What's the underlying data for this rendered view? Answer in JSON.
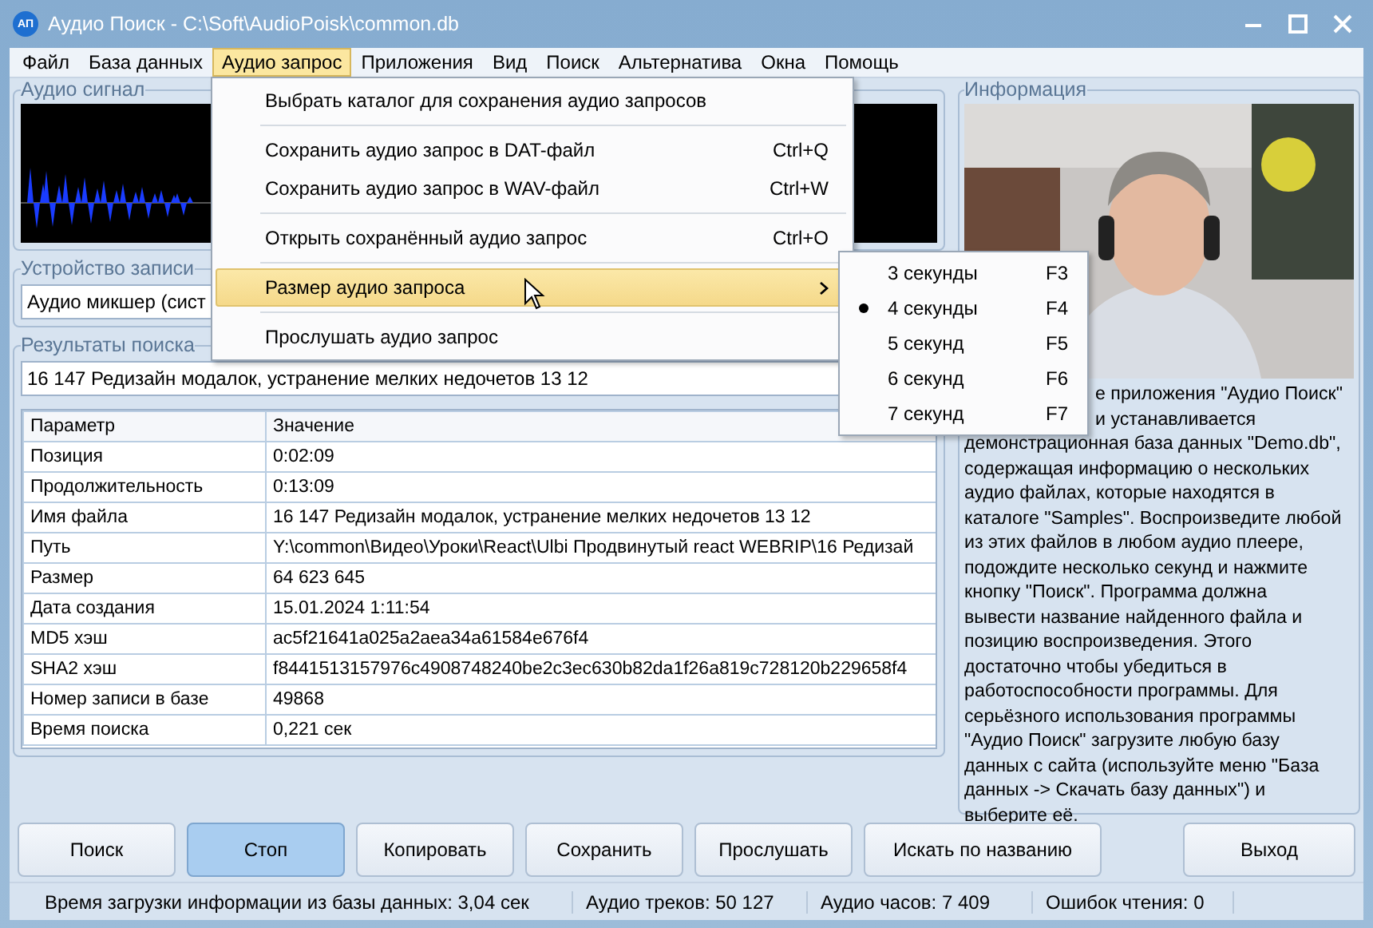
{
  "window": {
    "icon_text": "АП",
    "title": "Аудио Поиск - C:\\Soft\\AudioPoisk\\common.db"
  },
  "menu_bar": [
    {
      "label": "Файл",
      "selected": false
    },
    {
      "label": "База данных",
      "selected": false
    },
    {
      "label": "Аудио запрос",
      "selected": true
    },
    {
      "label": "Приложения",
      "selected": false
    },
    {
      "label": "Вид",
      "selected": false
    },
    {
      "label": "Поиск",
      "selected": false
    },
    {
      "label": "Альтернатива",
      "selected": false
    },
    {
      "label": "Окна",
      "selected": false
    },
    {
      "label": "Помощь",
      "selected": false
    }
  ],
  "audio_signal": {
    "title": "Аудио сигнал"
  },
  "recording_device": {
    "title": "Устройство записи",
    "value": "Аудио микшер (сист"
  },
  "search_results": {
    "title": "Результаты поиска",
    "found": "16 147 Редизайн модалок, устранение мелких недочетов 13 12",
    "columns": [
      "Параметр",
      "Значение"
    ],
    "rows": [
      [
        "Позиция",
        "0:02:09"
      ],
      [
        "Продолжительность",
        "0:13:09"
      ],
      [
        "Имя файла",
        "16 147 Редизайн модалок, устранение мелких недочетов 13 12"
      ],
      [
        "Путь",
        "Y:\\common\\Видео\\Уроки\\React\\Ulbi Продвинутый react WEBRIP\\16 Редизай"
      ],
      [
        "Размер",
        "64 623 645"
      ],
      [
        "Дата создания",
        "15.01.2024 1:11:54"
      ],
      [
        "MD5 хэш",
        "ac5f21641a025a2aea34a61584e676f4"
      ],
      [
        "SHA2 хэш",
        "f8441513157976c4908748240be2c3ec630b82da1f26a819c728120b229658f4"
      ],
      [
        "Номер записи в базе",
        "49868"
      ],
      [
        "Время поиска",
        "0,221 сек"
      ]
    ]
  },
  "information": {
    "title": "Информация",
    "lines": [
      "е приложения \"Аудио Поиск\"",
      "и устанавливается",
      "демонстрационная база данных \"Demo.db\",",
      "содержащая информацию о нескольких",
      "аудио файлах, которые находятся в",
      "каталоге \"Samples\". Воспроизведите любой",
      "из этих файлов в любом аудио плеере,",
      "подождите несколько секунд и нажмите",
      "кнопку \"Поиск\". Программа должна",
      "вывести название найденного файла и",
      "позицию воспроизведения. Этого",
      "достаточно чтобы убедиться в",
      "работоспособности программы. Для",
      "серьёзного использования программы",
      "\"Аудио Поиск\" загрузите любую базу",
      "данных с сайта (используйте меню \"База",
      "данных -> Скачать базу данных\") и",
      "выберите её."
    ]
  },
  "buttons": [
    {
      "label": "Поиск",
      "selected": false
    },
    {
      "label": "Стоп",
      "selected": true
    },
    {
      "label": "Копировать",
      "selected": false
    },
    {
      "label": "Сохранить",
      "selected": false
    },
    {
      "label": "Прослушать",
      "selected": false
    },
    {
      "label": "Искать по названию",
      "selected": false
    },
    {
      "label": "Выход",
      "selected": false
    }
  ],
  "status_bar": [
    "Время загрузки информации из базы данных: 3,04 сек",
    "Аудио треков: 50 127",
    "Аудио часов: 7 409",
    "Ошибок чтения: 0"
  ],
  "dropdown_menu": [
    {
      "kind": "item",
      "label": "Выбрать каталог для сохранения аудио запросов",
      "selected": false
    },
    {
      "kind": "separator"
    },
    {
      "kind": "item",
      "label": "Сохранить аудио запрос в DAT-файл",
      "shortcut": "Ctrl+Q",
      "selected": false
    },
    {
      "kind": "item",
      "label": "Сохранить аудио запрос в WAV-файл",
      "shortcut": "Ctrl+W",
      "selected": false
    },
    {
      "kind": "separator"
    },
    {
      "kind": "item",
      "label": "Открыть сохранённый аудио запрос",
      "shortcut": "Ctrl+O",
      "selected": false
    },
    {
      "kind": "separator"
    },
    {
      "kind": "submenu",
      "label": "Размер аудио запроса",
      "selected": true
    },
    {
      "kind": "separator"
    },
    {
      "kind": "item",
      "label": "Прослушать аудио запрос",
      "selected": false
    }
  ],
  "submenu": [
    {
      "label": "3 секунды",
      "shortcut": "F3",
      "checked": false
    },
    {
      "label": "4 секунды",
      "shortcut": "F4",
      "checked": true
    },
    {
      "label": "5 секунд",
      "shortcut": "F5",
      "checked": false
    },
    {
      "label": "6 секунд",
      "shortcut": "F6",
      "checked": false
    },
    {
      "label": "7 секунд",
      "shortcut": "F7",
      "checked": false
    }
  ]
}
